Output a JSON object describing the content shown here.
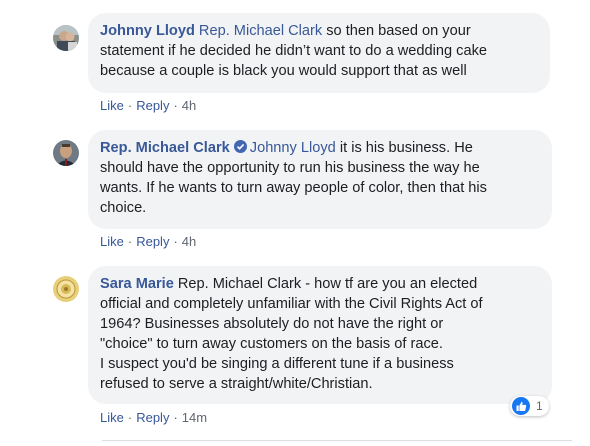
{
  "comments": [
    {
      "author": "Johnny Lloyd",
      "mention": "Rep. Michael Clark",
      "text_line1_rest": " so then based on your",
      "text_line2": "statement if he decided he didn’t want to do a wedding cake",
      "text_line3": "because a couple is black you would support that as well",
      "like": "Like",
      "reply": "Reply",
      "time": "4h",
      "avatar_icon": "user-avatar-johnny"
    },
    {
      "author": "Rep. Michael Clark",
      "verified_icon": "verified-badge-icon",
      "mention": "Johnny Lloyd",
      "text_line1_rest": " it is his business. He",
      "text_line2": "should have the opportunity to run his business the way he",
      "text_line3": "wants. If he wants to turn away people of color, then that his",
      "text_line4": "choice.",
      "like": "Like",
      "reply": "Reply",
      "time": "4h",
      "avatar_icon": "user-avatar-michael"
    },
    {
      "author": "Sara Marie",
      "text_line1_rest": " Rep. Michael Clark - how tf are you an elected",
      "text_line2": "official and completely unfamiliar with the Civil Rights Act of",
      "text_line3": "1964? Businesses absolutely do not have the right or",
      "text_line4": "\"choice\" to turn away customers on the basis of race.",
      "text_line5": "I suspect you'd be singing a different tune if a business",
      "text_line6": "refused to serve a straight/white/Christian.",
      "like": "Like",
      "reply": "Reply",
      "time": "14m",
      "reaction_count": "1",
      "avatar_icon": "user-avatar-sara"
    }
  ],
  "colors": {
    "link": "#385898",
    "bubble": "#f2f3f5",
    "meta": "#606770",
    "like_blue": "#1877f2"
  }
}
